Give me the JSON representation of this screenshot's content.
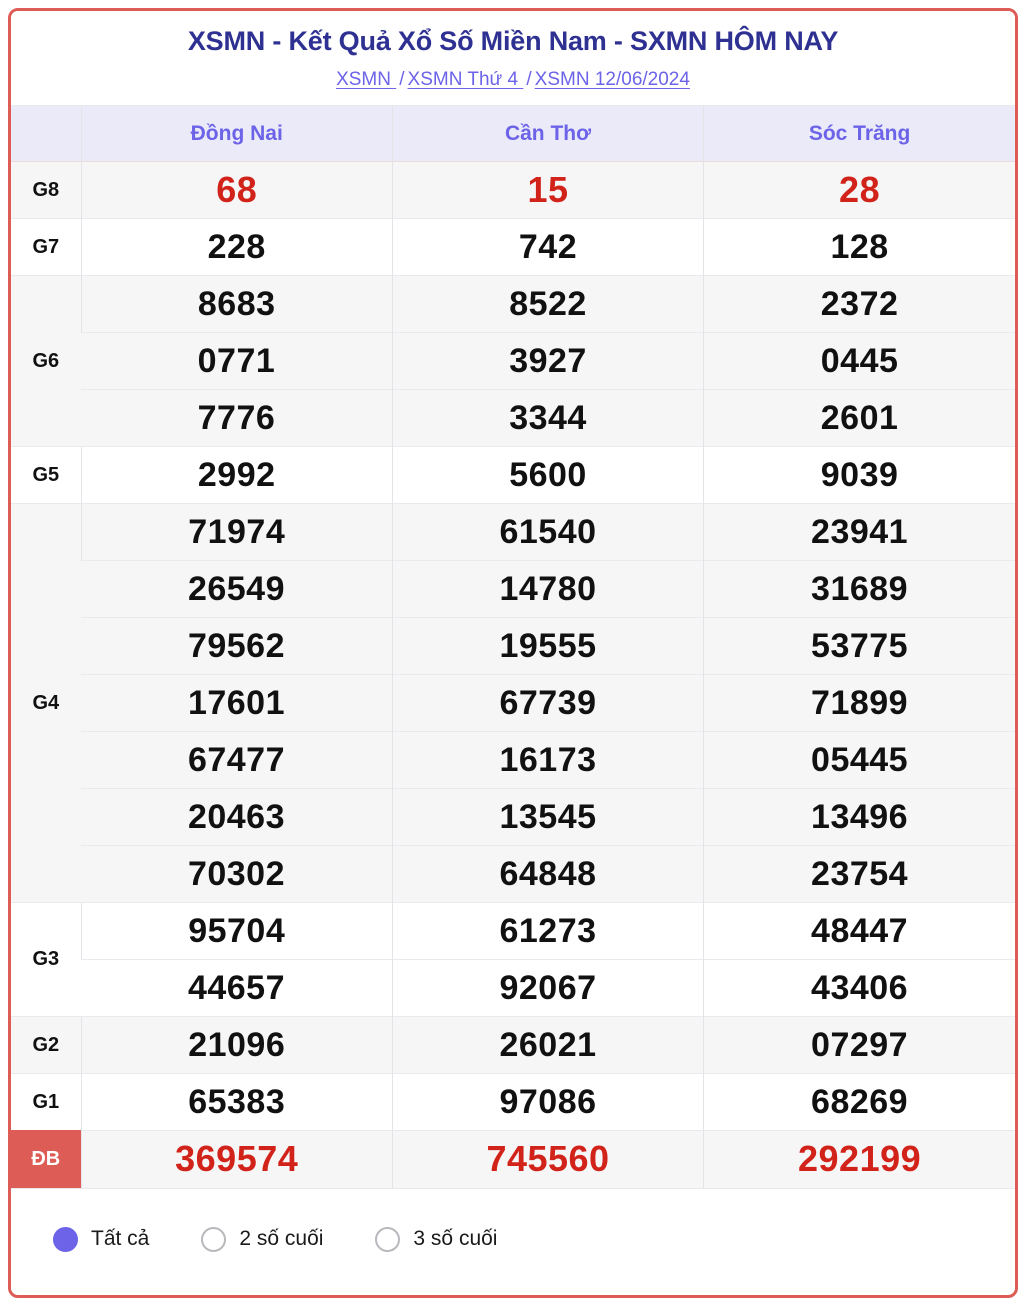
{
  "header": {
    "title": "XSMN - Kết Quả Xổ Số Miền Nam - SXMN HÔM NAY",
    "breadcrumb": {
      "items": [
        "XSMN ",
        "XSMN Thứ 4 ",
        "XSMN 12/06/2024"
      ],
      "separator": "/"
    }
  },
  "table": {
    "blank_header": "",
    "columns": [
      "Đồng Nai",
      "Cần Thơ",
      "Sóc Trăng"
    ],
    "rows": [
      {
        "label": "G8",
        "style": "shade",
        "red": true,
        "values": [
          [
            "68"
          ],
          [
            "15"
          ],
          [
            "28"
          ]
        ]
      },
      {
        "label": "G7",
        "style": "plain",
        "red": false,
        "values": [
          [
            "228"
          ],
          [
            "742"
          ],
          [
            "128"
          ]
        ]
      },
      {
        "label": "G6",
        "style": "shade",
        "red": false,
        "values": [
          [
            "8683",
            "0771",
            "7776"
          ],
          [
            "8522",
            "3927",
            "3344"
          ],
          [
            "2372",
            "0445",
            "2601"
          ]
        ]
      },
      {
        "label": "G5",
        "style": "plain",
        "red": false,
        "values": [
          [
            "2992"
          ],
          [
            "5600"
          ],
          [
            "9039"
          ]
        ]
      },
      {
        "label": "G4",
        "style": "shade",
        "red": false,
        "values": [
          [
            "71974",
            "26549",
            "79562",
            "17601",
            "67477",
            "20463",
            "70302"
          ],
          [
            "61540",
            "14780",
            "19555",
            "67739",
            "16173",
            "13545",
            "64848"
          ],
          [
            "23941",
            "31689",
            "53775",
            "71899",
            "05445",
            "13496",
            "23754"
          ]
        ]
      },
      {
        "label": "G3",
        "style": "plain",
        "red": false,
        "values": [
          [
            "95704",
            "44657"
          ],
          [
            "61273",
            "92067"
          ],
          [
            "48447",
            "43406"
          ]
        ]
      },
      {
        "label": "G2",
        "style": "shade",
        "red": false,
        "values": [
          [
            "21096"
          ],
          [
            "26021"
          ],
          [
            "07297"
          ]
        ]
      },
      {
        "label": "G1",
        "style": "plain",
        "red": false,
        "values": [
          [
            "65383"
          ],
          [
            "97086"
          ],
          [
            "68269"
          ]
        ]
      },
      {
        "label": "ĐB",
        "style": "db",
        "red": true,
        "values": [
          [
            "369574"
          ],
          [
            "745560"
          ],
          [
            "292199"
          ]
        ]
      }
    ]
  },
  "footer": {
    "filters": [
      {
        "label": "Tất cả",
        "selected": true
      },
      {
        "label": "2 số cuối",
        "selected": false
      },
      {
        "label": "3 số cuối",
        "selected": false
      }
    ]
  },
  "colors": {
    "frame": "#dd5c55",
    "title": "#2e3192",
    "accent_purple": "#6c63e8",
    "header_bg": "#eaeaf8",
    "number_red": "#d2231a",
    "shade_bg": "#f6f6f6"
  }
}
